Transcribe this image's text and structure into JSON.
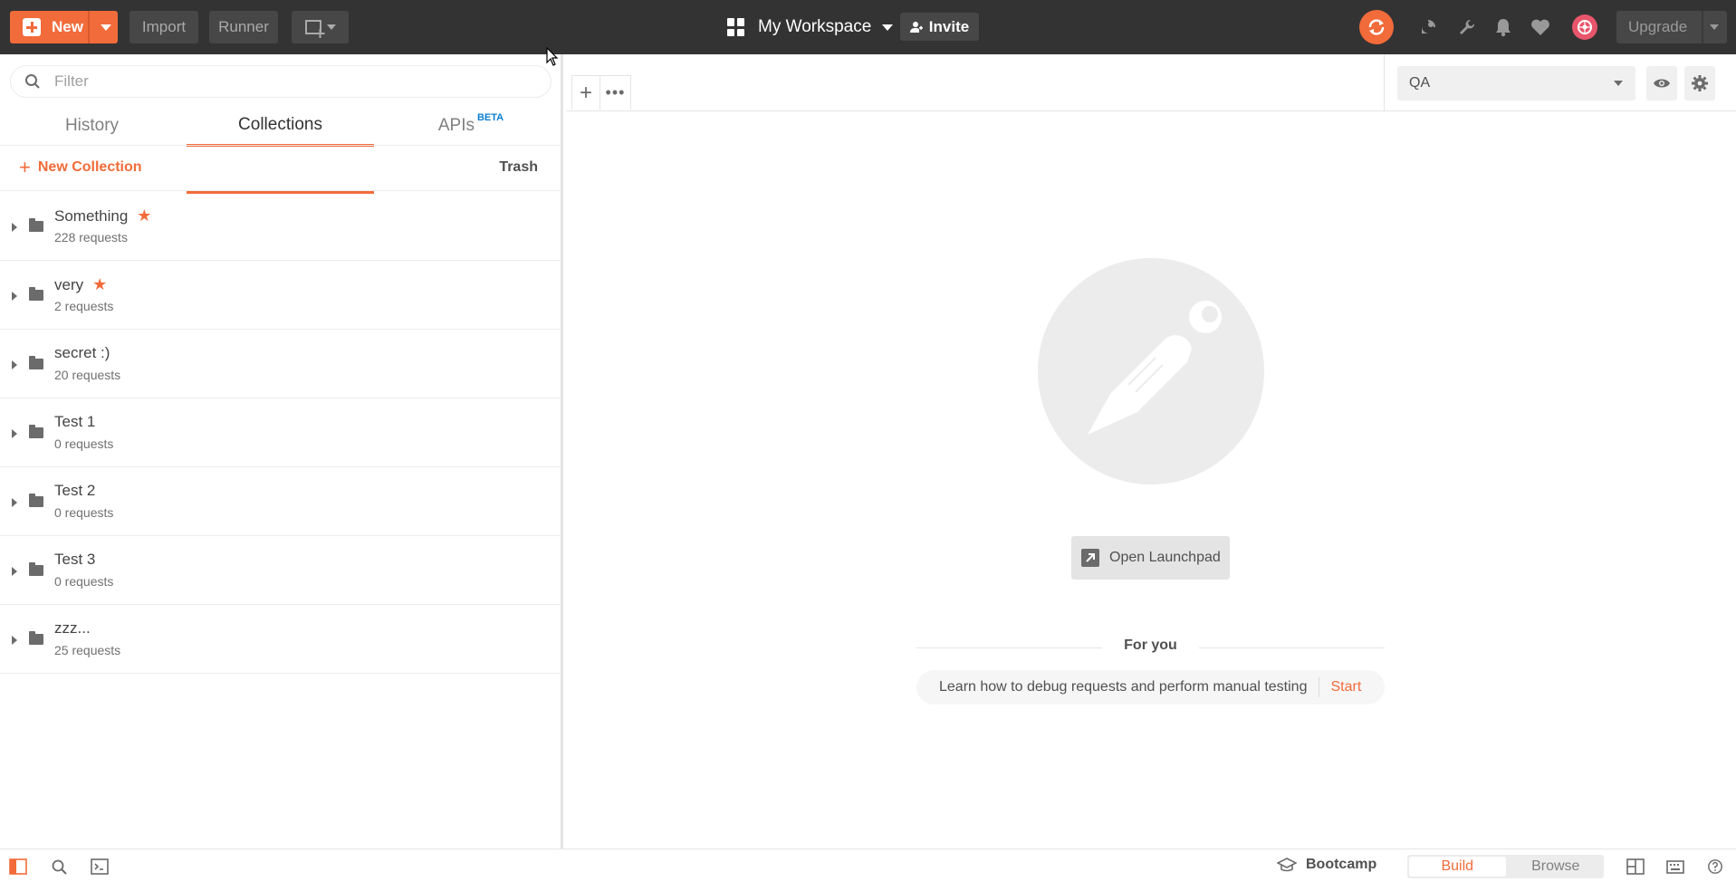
{
  "topbar": {
    "new_label": "New",
    "import_label": "Import",
    "runner_label": "Runner",
    "workspace_name": "My Workspace",
    "invite_label": "Invite",
    "upgrade_label": "Upgrade",
    "icons": [
      "sync-icon",
      "satellite-icon",
      "wrench-icon",
      "bell-icon",
      "heart-icon",
      "avatar-icon"
    ]
  },
  "sidebar": {
    "filter_placeholder": "Filter",
    "tabs": [
      {
        "label": "History"
      },
      {
        "label": "Collections"
      },
      {
        "label": "APIs",
        "badge": "BETA"
      }
    ],
    "new_collection_label": "New Collection",
    "trash_label": "Trash",
    "collections": [
      {
        "name": "Something",
        "count": "228 requests",
        "starred": true
      },
      {
        "name": "very",
        "count": "2 requests",
        "starred": true
      },
      {
        "name": "secret :)",
        "count": "20 requests",
        "starred": false
      },
      {
        "name": "Test 1",
        "count": "0 requests",
        "starred": false
      },
      {
        "name": "Test 2",
        "count": "0 requests",
        "starred": false
      },
      {
        "name": "Test 3",
        "count": "0 requests",
        "starred": false
      },
      {
        "name": "zzz...",
        "count": "25 requests",
        "starred": false
      }
    ]
  },
  "main": {
    "environment": "QA",
    "launchpad_label": "Open Launchpad",
    "for_you_label": "For you",
    "learn_text": "Learn how to debug requests and perform manual testing",
    "start_label": "Start"
  },
  "statusbar": {
    "bootcamp_label": "Bootcamp",
    "build_label": "Build",
    "browse_label": "Browse"
  },
  "colors": {
    "accent": "#f26b3a",
    "topbar": "#333333",
    "beta": "#0a7ed1"
  }
}
